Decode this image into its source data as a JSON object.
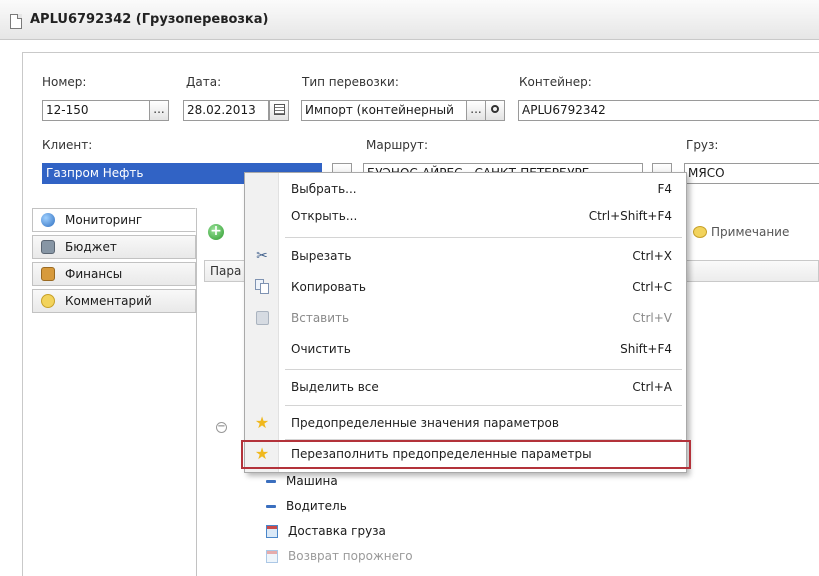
{
  "window": {
    "title": "APLU6792342 (Грузоперевозка)"
  },
  "form": {
    "nomer_label": "Номер:",
    "nomer_value": "12-150",
    "data_label": "Дата:",
    "data_value": "28.02.2013",
    "tip_label": "Тип перевозки:",
    "tip_value": "Импорт (контейнерный",
    "container_label": "Контейнер:",
    "container_value": "APLU6792342",
    "client_label": "Клиент:",
    "client_value": "Газпром Нефть",
    "route_label": "Маршрут:",
    "route_value": "БУЭНОС-АЙРЕС - САНКТ-ПЕТЕРБУРГ",
    "cargo_label": "Груз:",
    "cargo_value": "МЯСО",
    "ellipsis": "...",
    "search_glyph": "🔍"
  },
  "tabs": [
    {
      "label": "Мониторинг",
      "active": true,
      "color": "#3a7fd0"
    },
    {
      "label": "Бюджет",
      "active": false,
      "color": "#6d7f8f"
    },
    {
      "label": "Финансы",
      "active": false,
      "color": "#b9792a"
    },
    {
      "label": "Комментарий",
      "active": false,
      "color": "#e3c24a"
    }
  ],
  "toolbar": {
    "note_label": "Примечание",
    "grid_header_partial": "Пара"
  },
  "tree": [
    {
      "label": "Машина",
      "icon": "dash-icon",
      "disabled": false
    },
    {
      "label": "Водитель",
      "icon": "dash-icon",
      "disabled": false
    },
    {
      "label": "Доставка груза",
      "icon": "calendar-icon",
      "disabled": false
    },
    {
      "label": "Возврат порожнего",
      "icon": "calendar-icon",
      "disabled": true
    }
  ],
  "context_menu": {
    "items": [
      {
        "label": "Выбрать...",
        "shortcut": "F4",
        "icon": "",
        "disabled": false
      },
      {
        "label": "Открыть...",
        "shortcut": "Ctrl+Shift+F4",
        "icon": "",
        "disabled": false
      },
      {
        "label": "Вырезать",
        "shortcut": "Ctrl+X",
        "icon": "scissors-icon",
        "disabled": false
      },
      {
        "label": "Копировать",
        "shortcut": "Ctrl+C",
        "icon": "copy-icon",
        "disabled": false
      },
      {
        "label": "Вставить",
        "shortcut": "Ctrl+V",
        "icon": "paste-icon",
        "disabled": true
      },
      {
        "label": "Очистить",
        "shortcut": "Shift+F4",
        "icon": "",
        "disabled": false
      },
      {
        "label": "Выделить все",
        "shortcut": "Ctrl+A",
        "icon": "",
        "disabled": false
      },
      {
        "label": "Предопределенные значения параметров",
        "shortcut": "",
        "icon": "star-icon",
        "disabled": false
      },
      {
        "label": "Перезаполнить предопределенные параметры",
        "shortcut": "",
        "icon": "star-icon",
        "disabled": false
      }
    ]
  },
  "colors": {
    "selection": "#3163c5",
    "highlight_border": "#b3323a",
    "star": "#f0b81e"
  }
}
